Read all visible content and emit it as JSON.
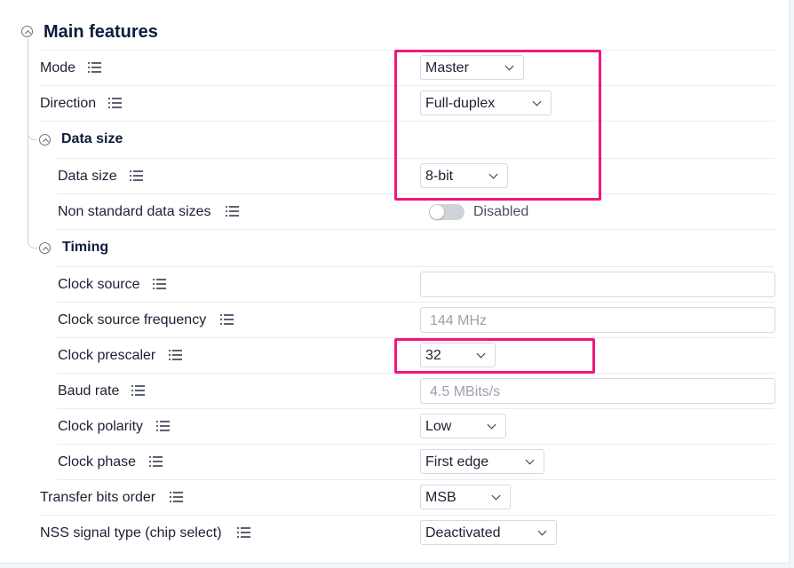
{
  "section": {
    "title": "Main features"
  },
  "rows": {
    "mode": {
      "label": "Mode",
      "value": "Master"
    },
    "direction": {
      "label": "Direction",
      "value": "Full-duplex"
    },
    "data_size_group": {
      "title": "Data size"
    },
    "data_size": {
      "label": "Data size",
      "value": "8-bit"
    },
    "non_standard": {
      "label": "Non standard data sizes",
      "toggle_state": "Disabled",
      "enabled": false
    },
    "timing_group": {
      "title": "Timing"
    },
    "clock_source": {
      "label": "Clock source",
      "value": ""
    },
    "clock_source_frequency": {
      "label": "Clock source frequency",
      "value": "144 MHz"
    },
    "clock_prescaler": {
      "label": "Clock prescaler",
      "value": "32"
    },
    "baud_rate": {
      "label": "Baud rate",
      "value": "4.5 MBits/s"
    },
    "clock_polarity": {
      "label": "Clock polarity",
      "value": "Low"
    },
    "clock_phase": {
      "label": "Clock phase",
      "value": "First edge"
    },
    "transfer_bits_order": {
      "label": "Transfer bits order",
      "value": "MSB"
    },
    "nss_signal_type": {
      "label": "NSS signal type (chip select)",
      "value": "Deactivated"
    }
  },
  "icons": {
    "collapse": "chevron-up-circle-icon",
    "details": "list-icon"
  },
  "colors": {
    "highlight": "#f0167e",
    "title": "#0f1b3d"
  }
}
